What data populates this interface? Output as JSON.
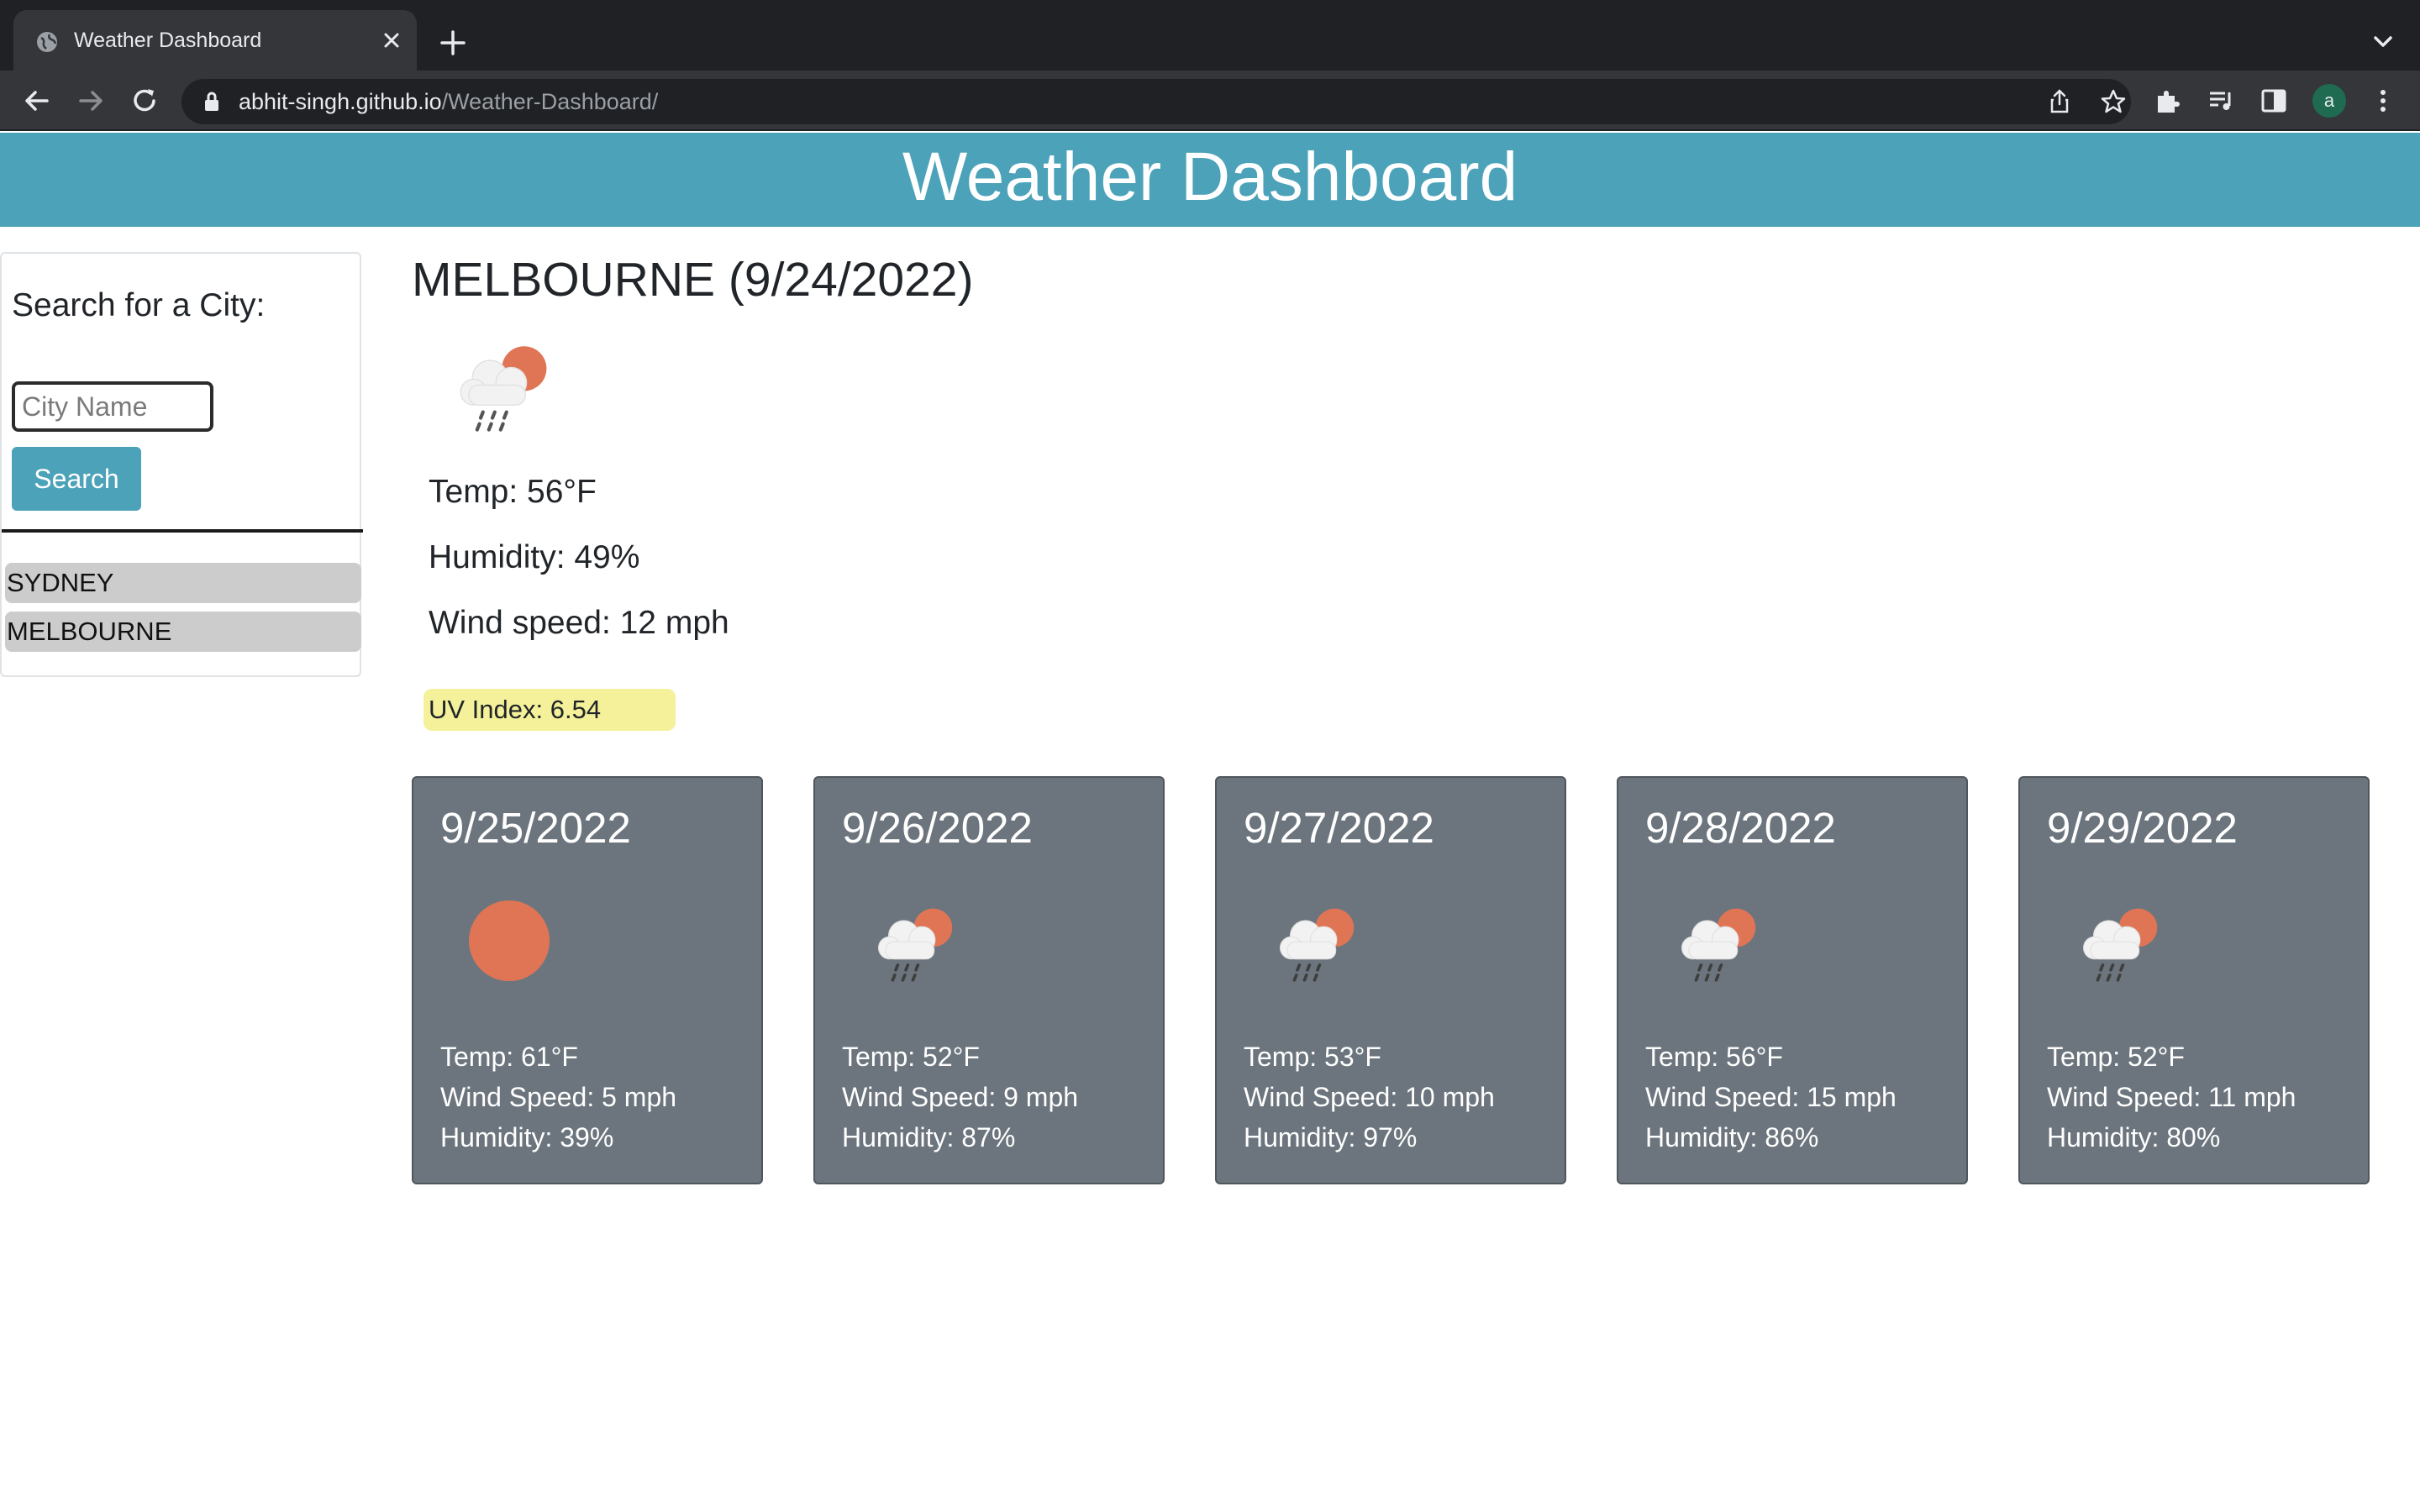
{
  "browser": {
    "tab_title": "Weather Dashboard",
    "url_host": "abhit-singh.github.io",
    "url_path": "/Weather-Dashboard/",
    "profile_initial": "a"
  },
  "header": {
    "title": "Weather Dashboard"
  },
  "sidebar": {
    "search_label": "Search for a City:",
    "input_placeholder": "City Name",
    "input_value": "",
    "search_button": "Search",
    "history": [
      "SYDNEY",
      "MELBOURNE"
    ]
  },
  "current": {
    "heading": "MELBOURNE (9/24/2022)",
    "icon": "rain-cloud-sun-icon",
    "temp": "Temp: 56°F",
    "humidity": "Humidity: 49%",
    "wind": "Wind speed: 12 mph",
    "uv": "UV Index: 6.54",
    "uv_color": "#f4f19a"
  },
  "forecast": [
    {
      "date": "9/25/2022",
      "icon": "sun-icon",
      "temp": "Temp: 61°F",
      "wind": "Wind Speed: 5 mph",
      "humidity": "Humidity: 39%"
    },
    {
      "date": "9/26/2022",
      "icon": "rain-cloud-sun-icon",
      "temp": "Temp: 52°F",
      "wind": "Wind Speed: 9 mph",
      "humidity": "Humidity: 87%"
    },
    {
      "date": "9/27/2022",
      "icon": "rain-cloud-sun-icon",
      "temp": "Temp: 53°F",
      "wind": "Wind Speed: 10 mph",
      "humidity": "Humidity: 97%"
    },
    {
      "date": "9/28/2022",
      "icon": "rain-cloud-sun-icon",
      "temp": "Temp: 56°F",
      "wind": "Wind Speed: 15 mph",
      "humidity": "Humidity: 86%"
    },
    {
      "date": "9/29/2022",
      "icon": "rain-cloud-sun-icon",
      "temp": "Temp: 52°F",
      "wind": "Wind Speed: 11 mph",
      "humidity": "Humidity: 80%"
    }
  ],
  "colors": {
    "header": "#4ca2b9",
    "card": "#6c757d",
    "sun": "#e07555"
  }
}
